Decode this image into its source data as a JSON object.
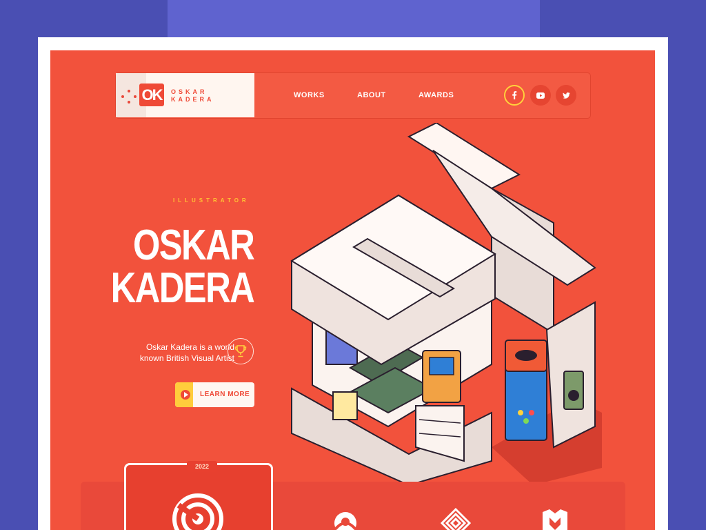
{
  "brand": {
    "logo_mark": "OK",
    "name_line1": "OSKAR",
    "name_line2": "KADERA"
  },
  "nav": {
    "items": [
      {
        "label": "WORKS"
      },
      {
        "label": "ABOUT"
      },
      {
        "label": "AWARDS"
      }
    ]
  },
  "social": [
    {
      "icon": "facebook-icon"
    },
    {
      "icon": "youtube-icon"
    },
    {
      "icon": "twitter-icon"
    }
  ],
  "hero": {
    "tagline": "ILLUSTRATOR",
    "title_line1": "OSKAR",
    "title_line2": "KADERA",
    "description_line1": "Oskar Kadera is a world",
    "description_line2": "known British Visual Artist",
    "cta_label": "LEARN MORE"
  },
  "awards": {
    "year": "2022",
    "icons": [
      "target-award-icon",
      "pin-award-icon",
      "maze-award-icon",
      "shield-award-icon"
    ]
  },
  "colors": {
    "background": "#4a4fb3",
    "canvas": "#f2523c",
    "accent_yellow": "#ffc233",
    "white": "#ffffff"
  }
}
